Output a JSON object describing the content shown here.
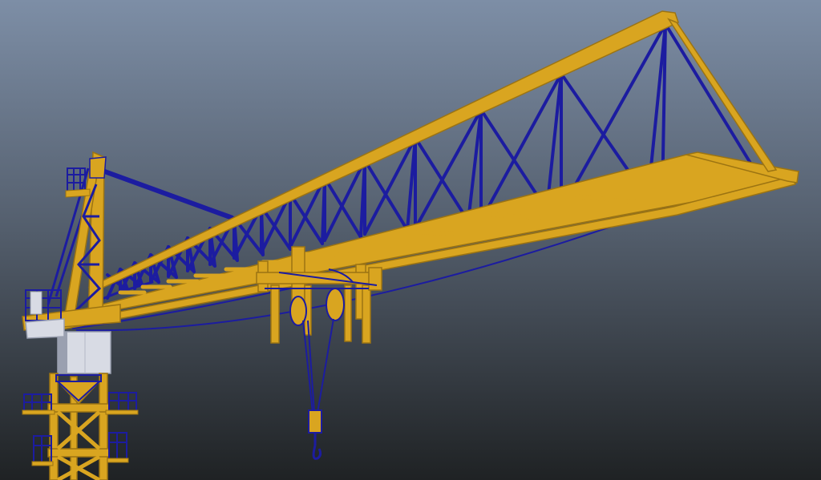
{
  "scene": {
    "subject": "tower-crane-wireframe-render",
    "colors": {
      "sky_top": "#7d8ea6",
      "sky_mid": "#566170",
      "sky_bottom": "#1f2224",
      "steel_yellow": "#d9a520",
      "steel_yellow_dark": "#9c7412",
      "wire_blue": "#1c1ca0",
      "cab_white": "#d8dbe4",
      "cab_shadow": "#9aa0b0"
    }
  }
}
